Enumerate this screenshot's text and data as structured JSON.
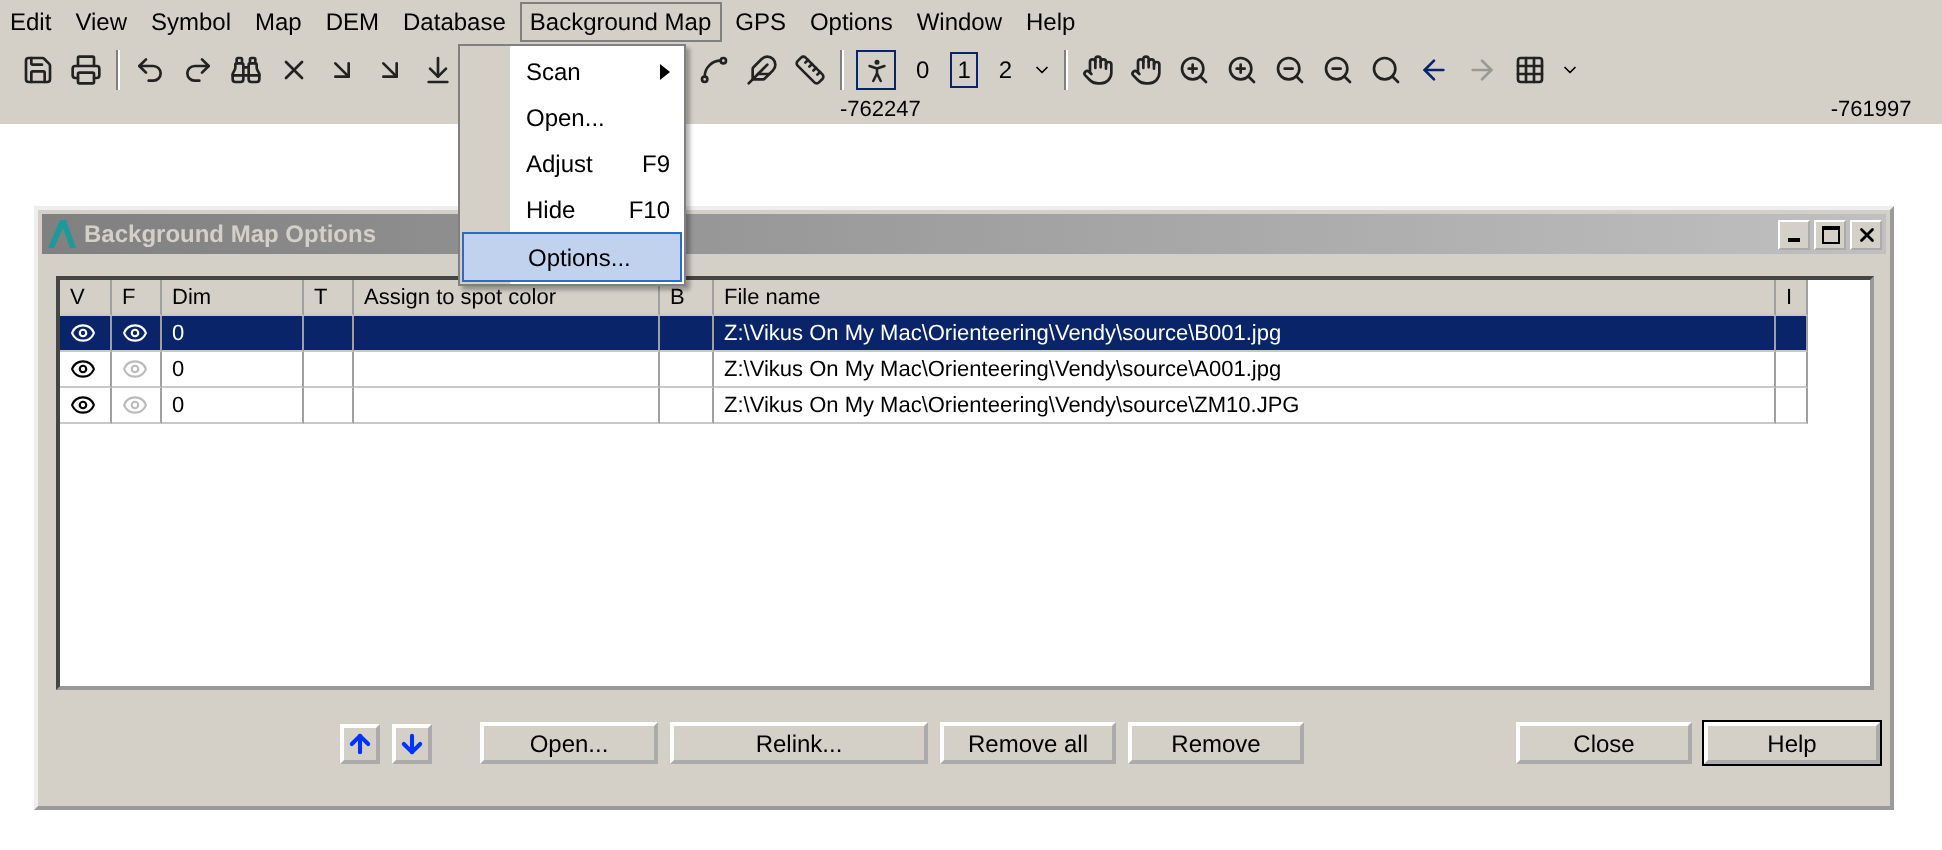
{
  "menu_bar": [
    {
      "label": "Edit",
      "selected": false
    },
    {
      "label": "View",
      "selected": false
    },
    {
      "label": "Symbol",
      "selected": false
    },
    {
      "label": "Map",
      "selected": false
    },
    {
      "label": "DEM",
      "selected": false
    },
    {
      "label": "Database",
      "selected": false
    },
    {
      "label": "Background Map",
      "selected": true
    },
    {
      "label": "GPS",
      "selected": false
    },
    {
      "label": "Options",
      "selected": false
    },
    {
      "label": "Window",
      "selected": false
    },
    {
      "label": "Help",
      "selected": false
    }
  ],
  "toolbar": {
    "levels": [
      {
        "label": "0",
        "selected": false
      },
      {
        "label": "1",
        "selected": true
      },
      {
        "label": "2",
        "selected": false
      }
    ]
  },
  "ruler": [
    "-762247",
    "-761997"
  ],
  "dropdown": [
    {
      "label": "Scan",
      "submenu": true,
      "selected": false
    },
    {
      "label": "Open...",
      "submenu": false,
      "selected": false
    },
    {
      "label": "Adjust",
      "shortcut": "F9",
      "submenu": false,
      "selected": false
    },
    {
      "label": "Hide",
      "shortcut": "F10",
      "submenu": false,
      "selected": false
    },
    {
      "label": "Options...",
      "submenu": false,
      "selected": true
    }
  ],
  "dialog": {
    "title": "Background Map Options",
    "columns": [
      "V",
      "F",
      "Dim",
      "T",
      "Assign to spot color",
      "B",
      "File name",
      "I"
    ],
    "rows": [
      {
        "visible": true,
        "fill": true,
        "dim": "0",
        "file": "Z:\\Vikus On My Mac\\Orienteering\\Vendy\\source\\B001.jpg",
        "selected": true
      },
      {
        "visible": true,
        "fill": false,
        "dim": "0",
        "file": "Z:\\Vikus On My Mac\\Orienteering\\Vendy\\source\\A001.jpg",
        "selected": false
      },
      {
        "visible": true,
        "fill": false,
        "dim": "0",
        "file": "Z:\\Vikus On My Mac\\Orienteering\\Vendy\\source\\ZM10.JPG",
        "selected": false
      }
    ],
    "buttons": [
      {
        "label": "Open...",
        "default": false
      },
      {
        "label": "Relink...",
        "default": false
      },
      {
        "label": "Remove all",
        "default": false
      },
      {
        "label": "Remove",
        "default": false
      }
    ],
    "right_buttons": [
      {
        "label": "Close",
        "default": false
      },
      {
        "label": "Help",
        "default": true
      }
    ]
  }
}
